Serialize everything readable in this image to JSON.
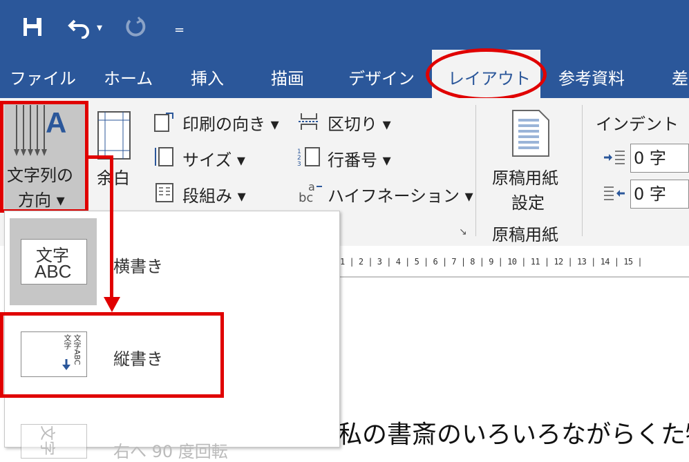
{
  "quick_access": {
    "save_icon": "save-icon",
    "undo_icon": "undo-icon",
    "undo_dropdown": "▾",
    "redo_icon": "redo-icon",
    "customize": "="
  },
  "tabs": [
    {
      "label": "ファイル"
    },
    {
      "label": "ホーム"
    },
    {
      "label": "挿入"
    },
    {
      "label": "描画"
    },
    {
      "label": "デザイン"
    },
    {
      "label": "レイアウト"
    },
    {
      "label": "参考資料"
    },
    {
      "label": "差"
    }
  ],
  "ribbon": {
    "text_direction": {
      "line1": "文字列の",
      "line2": "方向 ▾"
    },
    "margins": {
      "label": "余白"
    },
    "orientation": "印刷の向き ▾",
    "size": "サイズ ▾",
    "columns": "段組み ▾",
    "breaks": "区切り ▾",
    "line_numbers": "行番号 ▾",
    "hyphenation": "ハイフネーション ▾",
    "page_setup_launcher": "↘",
    "genko": {
      "line1": "原稿用紙",
      "line2": "設定",
      "group_label": "原稿用紙"
    },
    "indent": {
      "title": "インデント",
      "left_value": "0 字",
      "right_value": "0 字"
    }
  },
  "ruler": {
    "ticks": "1 | 2 | 3 | 4 | 5 | 6 | 7 | 8 | 9 | 10 | 11 | 12 | 13 | 14 | 15 |"
  },
  "document": {
    "text": "私の書斎のいろいろながらくた物"
  },
  "dropdown": {
    "items": [
      {
        "label": "横書き",
        "thumb_line1": "文字",
        "thumb_line2": "ABC"
      },
      {
        "label": "縦書き",
        "thumb_v1": "文字",
        "thumb_v2": "文字ABC"
      },
      {
        "label": "右へ 90 度回転",
        "thumb_v1": "文字"
      }
    ]
  },
  "colors": {
    "accent": "#2b579a",
    "annotation": "#e00000",
    "ribbon": "#f3f3f3"
  }
}
